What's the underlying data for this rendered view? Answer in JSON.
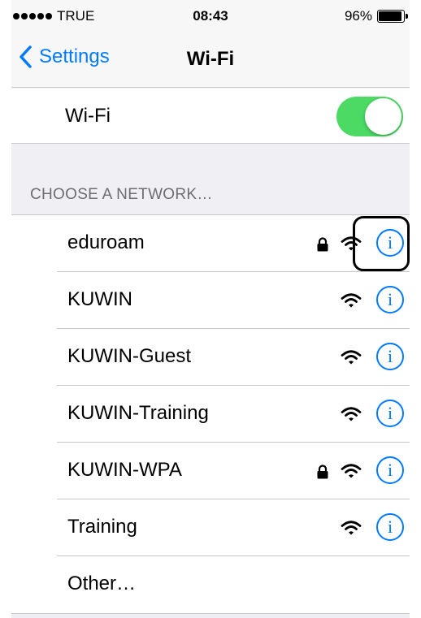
{
  "status_bar": {
    "carrier": "TRUE",
    "time": "08:43",
    "battery_percent": "96%",
    "battery_level": 0.96,
    "signal_bars": 5
  },
  "nav": {
    "back_label": "Settings",
    "title": "Wi-Fi"
  },
  "wifi_toggle": {
    "label": "Wi-Fi",
    "on": true,
    "on_color": "#4cd964"
  },
  "section_header": "CHOOSE A NETWORK…",
  "networks": [
    {
      "name": "eduroam",
      "secured": true
    },
    {
      "name": "KUWIN",
      "secured": false
    },
    {
      "name": "KUWIN-Guest",
      "secured": false
    },
    {
      "name": "KUWIN-Training",
      "secured": false
    },
    {
      "name": "KUWIN-WPA",
      "secured": true
    },
    {
      "name": "Training",
      "secured": false
    }
  ],
  "other_label": "Other…",
  "info_glyph": "i",
  "accent_color": "#007aff",
  "icons": {
    "lock": "lock-icon",
    "wifi": "wifi-signal-icon",
    "info": "info-icon",
    "back": "chevron-left-icon"
  }
}
